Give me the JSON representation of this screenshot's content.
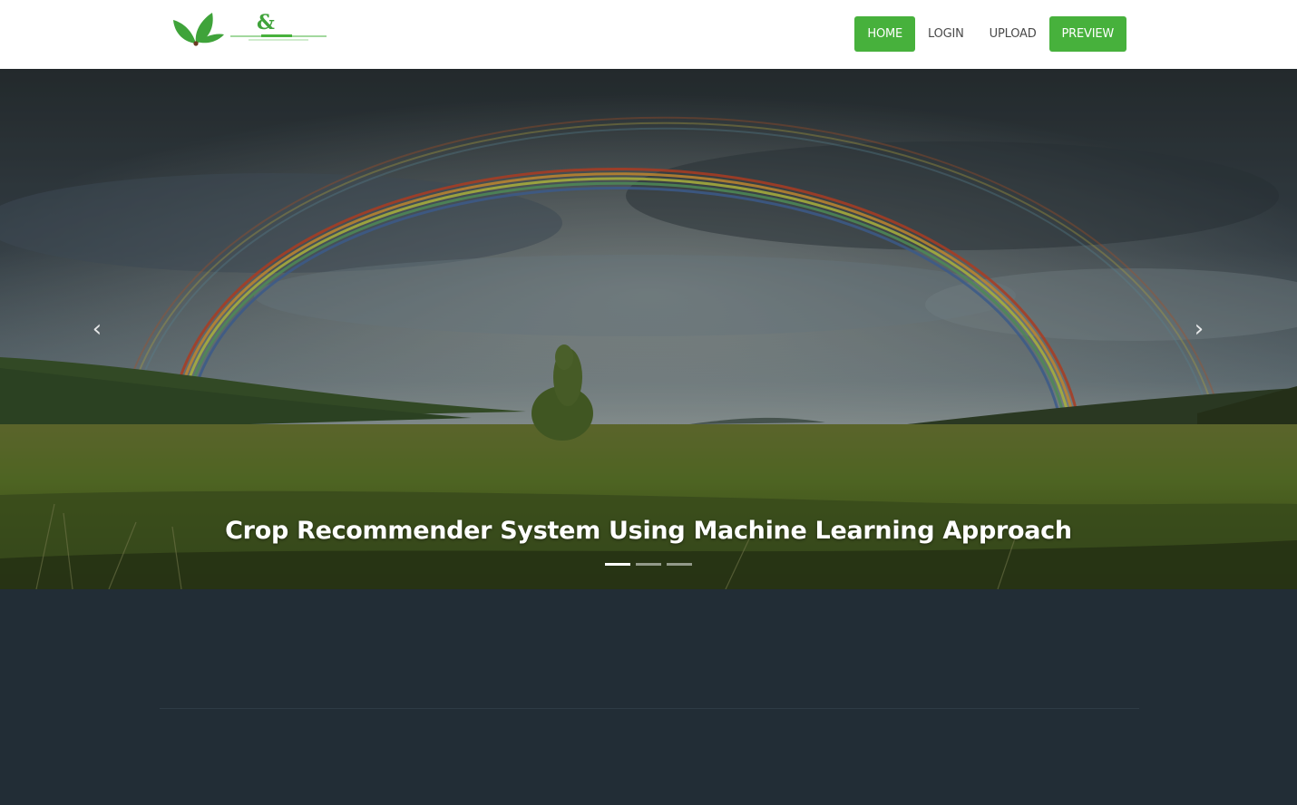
{
  "navbar": {
    "logo_glyph": "&",
    "items": [
      {
        "label": "HOME",
        "active": true
      },
      {
        "label": "LOGIN",
        "active": false
      },
      {
        "label": "UPLOAD",
        "active": false
      },
      {
        "label": "PREVIEW",
        "active": true
      }
    ]
  },
  "hero": {
    "caption": "Crop Recommender System Using Machine Learning Approach",
    "slide_count": 3,
    "active_slide": 1,
    "prev_icon": "chevron-left-icon",
    "next_icon": "chevron-right-icon"
  },
  "colors": {
    "accent": "#47b13c",
    "footer": "#222d36",
    "navbar": "#ffffff"
  }
}
